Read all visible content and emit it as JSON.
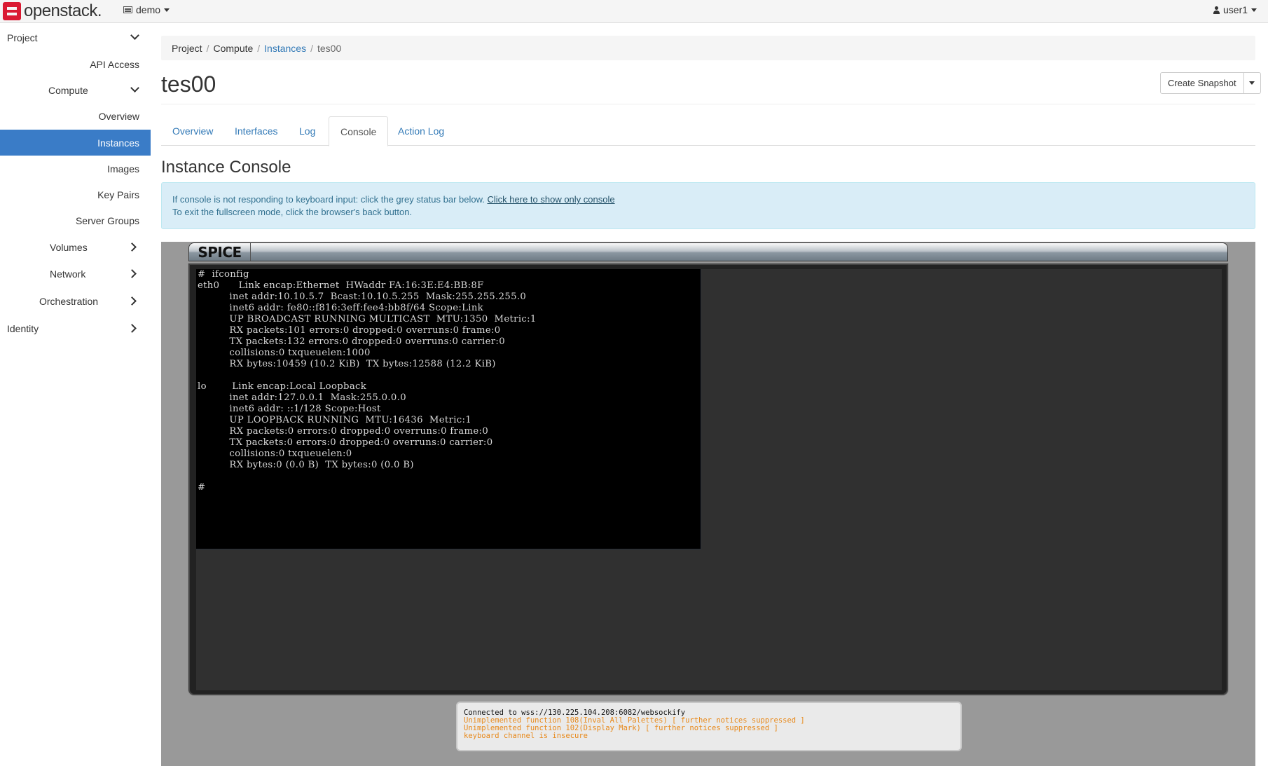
{
  "topbar": {
    "brand": "openstack.",
    "project": "demo",
    "user": "user1"
  },
  "sidebar": {
    "items": [
      {
        "label": "Project",
        "chevron": "down"
      },
      {
        "label": "API Access"
      },
      {
        "label": "Compute",
        "chevron": "down"
      },
      {
        "label": "Overview"
      },
      {
        "label": "Instances",
        "active": true
      },
      {
        "label": "Images"
      },
      {
        "label": "Key Pairs"
      },
      {
        "label": "Server Groups"
      },
      {
        "label": "Volumes",
        "chevron": "right"
      },
      {
        "label": "Network",
        "chevron": "right"
      },
      {
        "label": "Orchestration",
        "chevron": "right"
      },
      {
        "label": "Identity",
        "chevron": "right"
      }
    ]
  },
  "breadcrumb": {
    "items": [
      "Project",
      "Compute",
      "Instances",
      "tes00"
    ],
    "separator": "/"
  },
  "page": {
    "title": "tes00",
    "create_snapshot": "Create Snapshot"
  },
  "tabs": [
    "Overview",
    "Interfaces",
    "Log",
    "Console",
    "Action Log"
  ],
  "console": {
    "title": "Instance Console",
    "info_line1": "If console is not responding to keyboard input: click the grey status bar below.",
    "info_link": "Click here to show only console",
    "info_line2": "To exit the fullscreen mode, click the browser's back button.",
    "spice_label": "SPICE",
    "terminal_text": "#  ifconfig\neth0      Link encap:Ethernet  HWaddr FA:16:3E:E4:BB:8F\n          inet addr:10.10.5.7  Bcast:10.10.5.255  Mask:255.255.255.0\n          inet6 addr: fe80::f816:3eff:fee4:bb8f/64 Scope:Link\n          UP BROADCAST RUNNING MULTICAST  MTU:1350  Metric:1\n          RX packets:101 errors:0 dropped:0 overruns:0 frame:0\n          TX packets:132 errors:0 dropped:0 overruns:0 carrier:0\n          collisions:0 txqueuelen:1000\n          RX bytes:10459 (10.2 KiB)  TX bytes:12588 (12.2 KiB)\n\nlo        Link encap:Local Loopback\n          inet addr:127.0.0.1  Mask:255.0.0.0\n          inet6 addr: ::1/128 Scope:Host\n          UP LOOPBACK RUNNING  MTU:16436  Metric:1\n          RX packets:0 errors:0 dropped:0 overruns:0 frame:0\n          TX packets:0 errors:0 dropped:0 overruns:0 carrier:0\n          collisions:0 txqueuelen:0\n          RX bytes:0 (0.0 B)  TX bytes:0 (0.0 B)\n\n#",
    "status_connected": "Connected to wss://130.225.104.208:6082/websockify",
    "status_warn1": "Unimplemented function 108(Inval All Palettes) [ further notices suppressed ]",
    "status_warn2": "Unimplemented function 102(Display Mark) [ further notices suppressed ]",
    "status_warn3": "keyboard channel is insecure"
  },
  "colors": {
    "brand_red": "#da1a32",
    "active_nav": "#3a7cc7",
    "link": "#337ab7",
    "warning_text": "#e8891a"
  }
}
